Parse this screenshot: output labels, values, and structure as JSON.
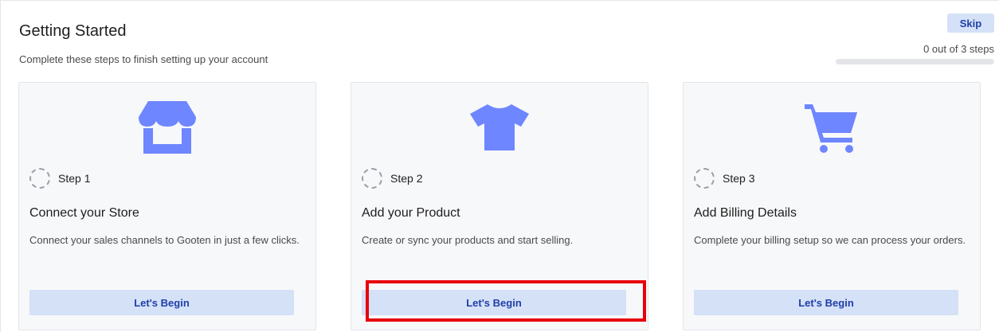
{
  "header": {
    "title": "Getting Started",
    "subtitle": "Complete these steps to finish setting up your account",
    "skip_label": "Skip",
    "steps_count": "0 out of 3 steps",
    "progress_fraction": 0
  },
  "cards": [
    {
      "icon": "storefront-icon",
      "step": "Step 1",
      "title": "Connect your Store",
      "description": "Connect your sales channels to Gooten in just a few clicks.",
      "button": "Let's Begin"
    },
    {
      "icon": "tshirt-icon",
      "step": "Step 2",
      "title": "Add your Product",
      "description": "Create or sync your products and start selling.",
      "button": "Let's Begin"
    },
    {
      "icon": "shopping-cart-icon",
      "step": "Step 3",
      "title": "Add Billing Details",
      "description": "Complete your billing setup so we can process your orders.",
      "button": "Let's Begin"
    }
  ],
  "colors": {
    "accent": "#6e86ff",
    "button_bg": "#d4e1f7",
    "button_text": "#1f3fa8",
    "highlight": "#e8000b"
  }
}
